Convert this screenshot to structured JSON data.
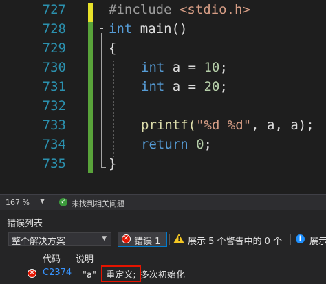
{
  "editor": {
    "line_numbers": [
      "727",
      "728",
      "729",
      "730",
      "731",
      "732",
      "733",
      "734",
      "735"
    ],
    "code": {
      "l727": {
        "directive": "#include",
        "header": "<stdio.h>"
      },
      "l728": {
        "type": "int",
        "name": "main()"
      },
      "l729": {
        "brace": "{"
      },
      "l730": {
        "type": "int",
        "rest": "a = ",
        "num": "10",
        "end": ";"
      },
      "l731": {
        "type": "int",
        "rest": "a = ",
        "num": "20",
        "end": ";"
      },
      "l733": {
        "fn": "printf(",
        "str": "\"%d %d\"",
        "rest": ", a, a);"
      },
      "l734": {
        "kw": "return",
        "num": "0",
        "end": ";"
      },
      "l735": {
        "brace": "}"
      }
    }
  },
  "status": {
    "zoom": "167 %",
    "message": "未找到相关问题"
  },
  "error_list": {
    "title": "错误列表",
    "scope": "整个解决方案",
    "errors_label": "错误 1",
    "warnings_label": "展示 5 个警告中的 0 个",
    "messages_label": "展示",
    "columns": {
      "code": "代码",
      "description": "说明"
    },
    "rows": [
      {
        "code": "C2374",
        "desc_prefix": "\"a\"",
        "desc_highlight": "重定义;",
        "desc_rest": "多次初始化"
      }
    ]
  },
  "colors": {
    "line_number": "#2b91af",
    "keyword": "#569cd6",
    "string": "#d69d85",
    "number": "#b5cea8",
    "function": "#dcdcaa",
    "change_saved": "#59a33a",
    "change_unsaved": "#e8e22a",
    "error": "#e51400",
    "warning": "#f3c623",
    "info": "#1e90ff"
  }
}
